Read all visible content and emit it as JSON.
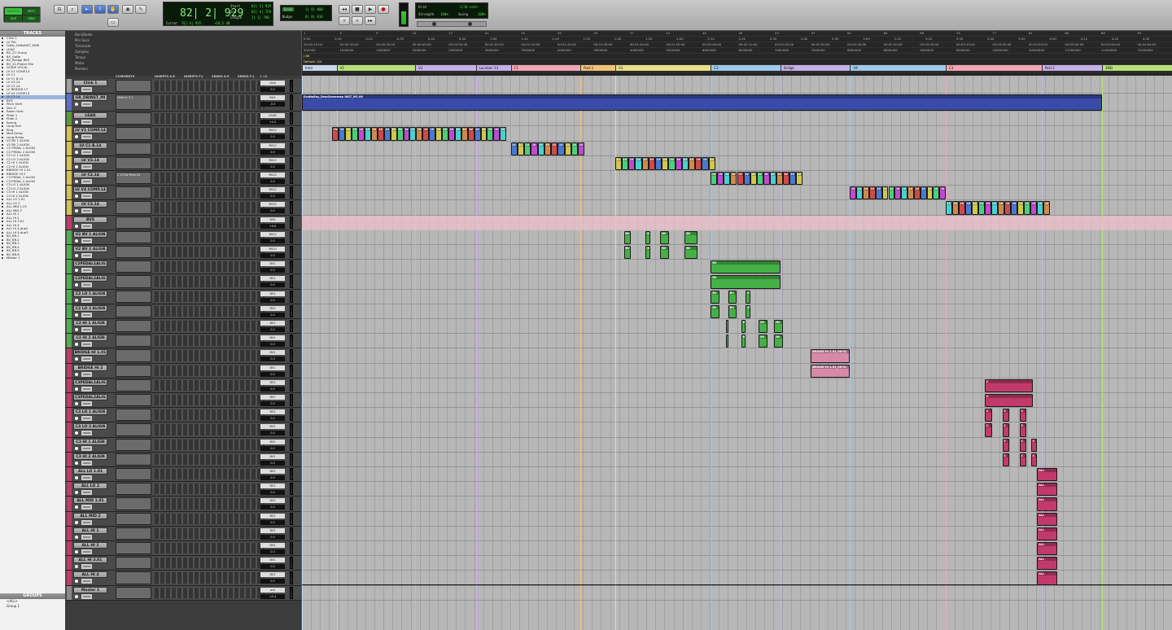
{
  "toolbar": {
    "mode_buttons": [
      "SHUFFLE",
      "SPOT",
      "SLIP",
      "GRID"
    ],
    "counter": "82| 2| 929",
    "start_label": "Start",
    "end_label": "End",
    "length_label": "Length",
    "start_val": "82| 2| 929",
    "end_val": "83| 4| 759",
    "length_val": "1| 1| 790",
    "cursor_label": "Cursor",
    "cursor_val": "76| 4| 935",
    "cursor_val2": "+18.5 dB",
    "grid_label": "Grid",
    "grid_val": "1| 0| 000",
    "nudge_label": "Nudge",
    "nudge_val": "0| 0| 010",
    "tempo_grid": "Grid",
    "tempo_val": "1/16 note",
    "strength_label": "Strength",
    "strength_val": "100%",
    "swing_label": "Swing",
    "swing_val": "100%"
  },
  "tracklist": {
    "title": "TRACKS",
    "items": [
      "Click 1",
      "LV Pre",
      "GoBy_DrBsINST_MXB",
      "LEAD",
      "BV_22-Group",
      "BV_GoBa",
      "BV_Bridge BVS",
      "BV_22-Pitoler Mix",
      "GUIDE VOCAL",
      "LV V1 COMP.14",
      "LV C1",
      "LV C1 B.14",
      "LV V3.14",
      "LV C2.14",
      "LV BRIDGE.17",
      "LV V4 COMP.14",
      "LV C3.14",
      "BVS",
      "Pitch Shift",
      "Dirs O",
      "Room Verb",
      "Plate 1",
      "Plate 2",
      "Spring",
      "Long Hall",
      "Sing",
      "Mod Delay",
      "Long Delay",
      "V2 BV 1 ALIGN",
      "V2 BV 2 ALIGN",
      "C2 PEDAL 1 ALIGN",
      "C2 PEDAL 2 ALIGN",
      "C2 LO 1 ALIGN",
      "C2 LO 2 ALIGN",
      "C2 HI 1 ALIGN",
      "C2 HI 2 ALIGN",
      "BRIDGE HI 1.01",
      "BRIDGE HI 2",
      "C3 PEDAL 1 ALIGN",
      "C3 PEDAL 2 ALIGN",
      "C3 LO 1 ALIGN",
      "C3 LO 2 ALIGN",
      "C3 HI 1 ALIGN",
      "C3 HI 2 ALIGN",
      "ALL LO 1.01",
      "ALL LO 2",
      "ALL MID 1.01",
      "ALL MID 2",
      "ALL HI 1",
      "ALL HI 2",
      "ALL HI 3.01",
      "ALL HI 4",
      "ALL HI 4.dup2",
      "ALL HI 4.dup3",
      "BV_BR.1",
      "BV_BR.2",
      "BV_BR.3",
      "BV_BR.4",
      "BV_BR.5",
      "BV_BR.6",
      "Master 1"
    ],
    "selected_index": 16
  },
  "groups": {
    "title": "GROUPS",
    "items": [
      "<ALL>",
      "Group 1"
    ]
  },
  "columns": [
    "COMMENTS",
    "INSERTS A-E",
    "INSERTS F-J",
    "SENDS A-E",
    "SENDS F-J",
    "I / O"
  ],
  "ruler_labels": [
    "Bars|Beats",
    "Min:Secs",
    "Timecode",
    "Samples",
    "Tempo",
    "Meter",
    "Markers"
  ],
  "bars": [
    "1",
    "5",
    "9",
    "13",
    "17",
    "21",
    "25",
    "29",
    "33",
    "37",
    "41",
    "45",
    "49",
    "53",
    "57",
    "61",
    "65",
    "69",
    "73",
    "77",
    "81",
    "85",
    "89",
    "93"
  ],
  "min_secs": [
    "0:00",
    "0:10",
    "0:20",
    "0:30",
    "0:40",
    "0:50",
    "1:00",
    "1:10",
    "1:20",
    "1:30",
    "1:40",
    "1:50",
    "2:00",
    "2:10",
    "2:20",
    "2:30",
    "2:40",
    "2:50",
    "3:00",
    "3:10",
    "3:20",
    "3:30",
    "3:40",
    "3:50",
    "4:00",
    "4:10",
    "4:20",
    "4:30"
  ],
  "timecode": [
    "00:00:10:00",
    "00:00:20:00",
    "00:00:30:00",
    "00:00:40:00",
    "00:00:50:00",
    "00:01:00:00",
    "00:01:10:00",
    "00:01:20:00",
    "00:01:30:00",
    "00:01:40:00",
    "00:01:50:00",
    "00:02:00:00",
    "00:02:10:00",
    "00:02:20:00",
    "00:02:30:00",
    "00:02:40:00",
    "00:02:50:00",
    "00:03:00:00",
    "00:03:10:00",
    "00:03:20:00",
    "00:03:30:00",
    "00:03:40:00",
    "00:03:50:00",
    "00:04:00:00"
  ],
  "samples": [
    "500000",
    "1000000",
    "1500000",
    "2000000",
    "2500000",
    "3000000",
    "3500000",
    "4000000",
    "4500000",
    "5000000",
    "5500000",
    "6000000",
    "6500000",
    "7000000",
    "7500000",
    "8000000",
    "8500000",
    "9000000",
    "9500000",
    "10000000",
    "10500000",
    "11000000",
    "11500000",
    "12000000"
  ],
  "tempo_text": "J 86",
  "meter_text": "Default: 4/4",
  "markers": [
    {
      "label": "Intro",
      "color": "#c8d7ea",
      "pos": 0.0
    },
    {
      "label": "V1",
      "color": "#b7e07a",
      "pos": 0.04
    },
    {
      "label": "V2",
      "color": "#c7b0e8",
      "pos": 0.13
    },
    {
      "label": "Location 13",
      "color": "#c7b0e8",
      "pos": 0.2
    },
    {
      "label": "C1",
      "color": "#f2a6b4",
      "pos": 0.24
    },
    {
      "label": "Post 1",
      "color": "#f2c27a",
      "pos": 0.32
    },
    {
      "label": "V3",
      "color": "#e9df8a",
      "pos": 0.36
    },
    {
      "label": "C2",
      "color": "#9ec9ea",
      "pos": 0.47
    },
    {
      "label": "Bridge",
      "color": "#c7b0e8",
      "pos": 0.55
    },
    {
      "label": "V4",
      "color": "#9ec9ea",
      "pos": 0.63
    },
    {
      "label": "C3",
      "color": "#f2a6b4",
      "pos": 0.74
    },
    {
      "label": "Post 2",
      "color": "#c7b0e8",
      "pos": 0.85
    },
    {
      "label": "END",
      "color": "#b7e07a",
      "pos": 0.92
    }
  ],
  "tracks": [
    {
      "name": "Click 1",
      "color": "#a0a0a0",
      "io": "click",
      "vol": "0.0",
      "comment": ""
    },
    {
      "name": "GR_DBINST_MI",
      "color": "#5b6fd1",
      "io": "BUS",
      "vol": "-5.5",
      "comment": "Click in 7.1"
    },
    {
      "name": "LEAD",
      "color": "#5a9a3a",
      "io": "LEAD",
      "vol": "+4.2",
      "comment": ""
    },
    {
      "name": "LV V1 COMP.14",
      "color": "#d4c24a",
      "io": "MICU",
      "vol": "0.0",
      "comment": ""
    },
    {
      "name": "LV C1 B.14",
      "color": "#d4c24a",
      "io": "MICU",
      "vol": "0.0",
      "comment": ""
    },
    {
      "name": "LV V3.14",
      "color": "#d4c24a",
      "io": "MICU",
      "vol": "0.0",
      "comment": ""
    },
    {
      "name": "LV C2.14",
      "color": "#d4c24a",
      "io": "MICU",
      "vol": "0.0",
      "comment": "C 13 for final 14"
    },
    {
      "name": "LV V4 COMP.14",
      "color": "#d4c24a",
      "io": "MICU",
      "vol": "0.0",
      "comment": ""
    },
    {
      "name": "LV C3.14",
      "color": "#d4c24a",
      "io": "MICU",
      "vol": "0.0",
      "comment": ""
    },
    {
      "name": "BVS",
      "color": "#c23a6a",
      "io": "BVS",
      "vol": "+6.6",
      "comment": ""
    },
    {
      "name": "V2 BV 1 ALIGN",
      "color": "#4cb04c",
      "io": "MICU",
      "vol": "0.0",
      "comment": ""
    },
    {
      "name": "V2 BV 2 ALIGN",
      "color": "#4cb04c",
      "io": "MICU",
      "vol": "0.0",
      "comment": ""
    },
    {
      "name": "C2PEDAL1ALIG",
      "color": "#4cb04c",
      "io": "BV1",
      "vol": "0.0",
      "comment": ""
    },
    {
      "name": "C2PEDAL2ALIG",
      "color": "#4cb04c",
      "io": "BV1",
      "vol": "0.0",
      "comment": ""
    },
    {
      "name": "C2 LO 1 ALIGN",
      "color": "#4cb04c",
      "io": "BV1",
      "vol": "0.0",
      "comment": ""
    },
    {
      "name": "C2 LO 2 ALIGN",
      "color": "#4cb04c",
      "io": "BV1",
      "vol": "0.0",
      "comment": ""
    },
    {
      "name": "C2 HI 1 ALIGN",
      "color": "#4cb04c",
      "io": "BV1",
      "vol": "0.0",
      "comment": ""
    },
    {
      "name": "C2 HI 2 ALIGN",
      "color": "#4cb04c",
      "io": "BV1",
      "vol": "0.0",
      "comment": ""
    },
    {
      "name": "BRIDGE HI 1.01",
      "color": "#c23a6a",
      "io": "BV1",
      "vol": "0.0",
      "comment": ""
    },
    {
      "name": "BRIDGE HI 2",
      "color": "#c23a6a",
      "io": "BV1",
      "vol": "0.0",
      "comment": ""
    },
    {
      "name": "C3PEDAL1ALIG",
      "color": "#c23a6a",
      "io": "BV1",
      "vol": "0.0",
      "comment": ""
    },
    {
      "name": "C3PEDAL2ALIG",
      "color": "#c23a6a",
      "io": "BV1",
      "vol": "0.0",
      "comment": ""
    },
    {
      "name": "C3 LO 1 ALIGN",
      "color": "#c23a6a",
      "io": "BV1",
      "vol": "0.0",
      "comment": ""
    },
    {
      "name": "C3 LO 2 ALIGN",
      "color": "#c23a6a",
      "io": "BV1",
      "vol": "0.0",
      "comment": ""
    },
    {
      "name": "C3 HI 1 ALIGN",
      "color": "#c23a6a",
      "io": "BV1",
      "vol": "0.0",
      "comment": ""
    },
    {
      "name": "C3 HI 2 ALIGN",
      "color": "#c23a6a",
      "io": "BV1",
      "vol": "0.0",
      "comment": ""
    },
    {
      "name": "ALL LO 1.01",
      "color": "#c23a6a",
      "io": "BV1",
      "vol": "0.0",
      "comment": ""
    },
    {
      "name": "ALL LO 2",
      "color": "#c23a6a",
      "io": "BV1",
      "vol": "0.0",
      "comment": ""
    },
    {
      "name": "ALL MID 1.01",
      "color": "#c23a6a",
      "io": "BV1",
      "vol": "0.0",
      "comment": ""
    },
    {
      "name": "ALL MID 2",
      "color": "#c23a6a",
      "io": "BV1",
      "vol": "0.0",
      "comment": ""
    },
    {
      "name": "ALL HI 1",
      "color": "#c23a6a",
      "io": "BV1",
      "vol": "0.0",
      "comment": ""
    },
    {
      "name": "ALL HI 2",
      "color": "#c23a6a",
      "io": "BV1",
      "vol": "0.0",
      "comment": ""
    },
    {
      "name": "ALL HI 3.01",
      "color": "#c23a6a",
      "io": "BV1",
      "vol": "0.0",
      "comment": ""
    },
    {
      "name": "ALL HI 4",
      "color": "#c23a6a",
      "io": "BV1",
      "vol": "0.0",
      "comment": ""
    },
    {
      "name": "Master 1",
      "color": "#8a8a8a",
      "io": "out",
      "vol": "-15.4",
      "comment": ""
    }
  ],
  "clip_labels": {
    "inst": "GrattaRay_DearSeverman INST_M2.06",
    "lv": "LV",
    "bv": "BV",
    "c": "C",
    "all": "ALL",
    "bridge": "BRIDGE HI 1.01_06-01"
  },
  "colors": {
    "inst_clip": "#3a4aa8",
    "green_clip": "#45b045",
    "pink_clip": "#c23a6a",
    "selection_band": "#e8c0c8"
  }
}
